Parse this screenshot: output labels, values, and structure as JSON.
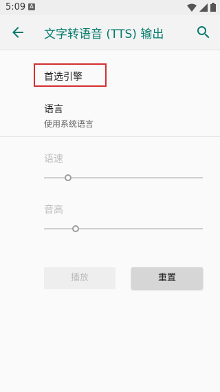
{
  "status_bar": {
    "time": "5:09",
    "notification_icon": "A"
  },
  "app_bar": {
    "title": "文字转语音 (TTS) 输出"
  },
  "preferences": {
    "preferred_engine": {
      "title": "首选引擎"
    },
    "language": {
      "title": "语言",
      "summary": "使用系统语言"
    },
    "speech_rate": {
      "title": "语速",
      "value": 0.15
    },
    "pitch": {
      "title": "音高",
      "value": 0.2
    }
  },
  "buttons": {
    "play": "播放",
    "reset": "重置"
  },
  "colors": {
    "accent": "#00796b",
    "highlight": "#d32f2f"
  }
}
